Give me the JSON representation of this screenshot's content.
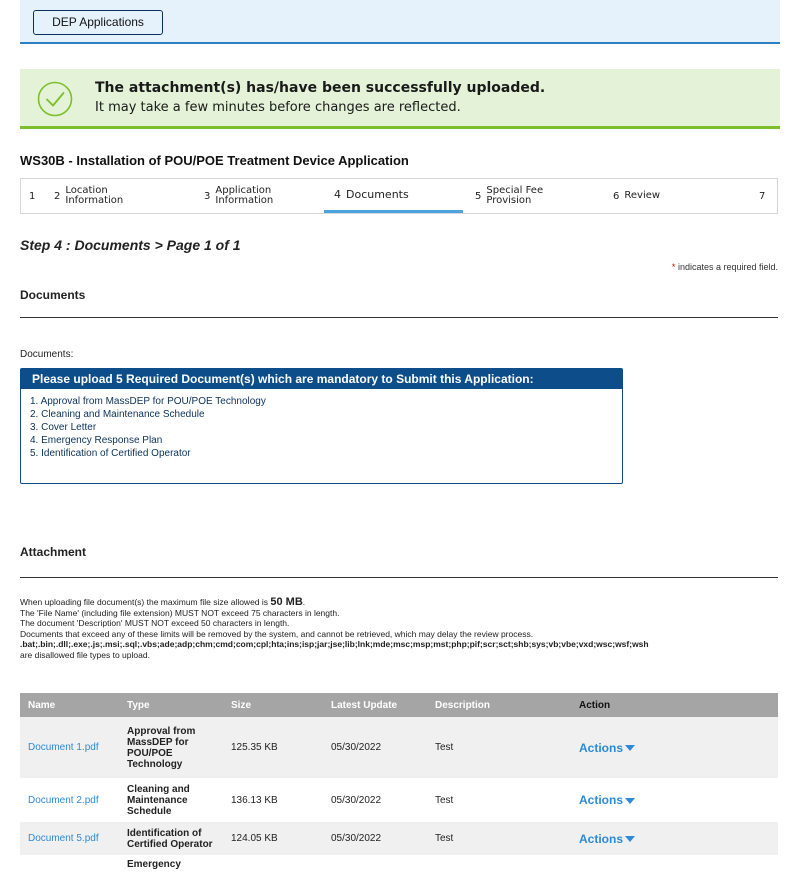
{
  "header": {
    "dep_button": "DEP Applications"
  },
  "success": {
    "line1": "The attachment(s) has/have been successfully uploaded.",
    "line2": "It may take a few minutes before changes are reflected.",
    "icon": "checkmark-circle-icon",
    "color": "#7bbf2a"
  },
  "app_title": "WS30B - Installation of POU/POE Treatment Device Application",
  "steps": [
    {
      "num": "1",
      "label": ""
    },
    {
      "num": "2",
      "label": "Location Information"
    },
    {
      "num": "3",
      "label": "Application Information"
    },
    {
      "num": "4",
      "label": "Documents"
    },
    {
      "num": "5",
      "label": "Special Fee Provision"
    },
    {
      "num": "6",
      "label": "Review"
    },
    {
      "num": "7",
      "label": ""
    }
  ],
  "step_heading": "Step 4 : Documents > Page 1 of 1",
  "required_note": {
    "star": "*",
    "text": " indicates a required field."
  },
  "documents_section": {
    "title": "Documents",
    "label": "Documents:",
    "box_header": "Please upload 5 Required Document(s) which are mandatory to Submit this Application:",
    "items": [
      "1. Approval from MassDEP for POU/POE Technology",
      "2. Cleaning and Maintenance Schedule",
      "3. Cover Letter",
      "4. Emergency Response Plan",
      "5. Identification of Certified Operator"
    ]
  },
  "attachment_section": {
    "title": "Attachment",
    "rule1_pre": "When uploading file document(s) the maximum file size allowed is ",
    "rule1_size": "50 MB",
    "rule1_post": ".",
    "rule2": "The 'File Name' (including file extension) MUST NOT exceed 75 characters in length.",
    "rule3": "The document 'Description' MUST NOT exceed 50 characters in length.",
    "rule4": "Documents that exceed any of these limits will be removed by the system, and cannot be retrieved, which may delay the review process.",
    "rule5": ".bat;.bin;.dll;.exe;.js;.msi;.sql;.vbs;ade;adp;chm;cmd;com;cpl;hta;ins;isp;jar;jse;lib;lnk;mde;msc;msp;mst;php;pif;scr;sct;shb;sys;vb;vbe;vxd;wsc;wsf;wsh",
    "rule6": "are disallowed file types to upload."
  },
  "table": {
    "headers": [
      "Name",
      "Type",
      "Size",
      "Latest Update",
      "Description",
      "Action"
    ],
    "rows": [
      {
        "name": "Document 1.pdf",
        "type": "Approval from MassDEP for POU/POE Technology",
        "size": "125.35 KB",
        "date": "05/30/2022",
        "desc": "Test",
        "action": "Actions"
      },
      {
        "name": "Document 2.pdf",
        "type": "Cleaning and Maintenance Schedule",
        "size": "136.13 KB",
        "date": "05/30/2022",
        "desc": "Test",
        "action": "Actions"
      },
      {
        "name": "Document 5.pdf",
        "type": "Identification of Certified Operator",
        "size": "124.05 KB",
        "date": "05/30/2022",
        "desc": "Test",
        "action": "Actions"
      },
      {
        "name": "",
        "type": "Emergency",
        "size": "",
        "date": "",
        "desc": "",
        "action": ""
      }
    ]
  }
}
